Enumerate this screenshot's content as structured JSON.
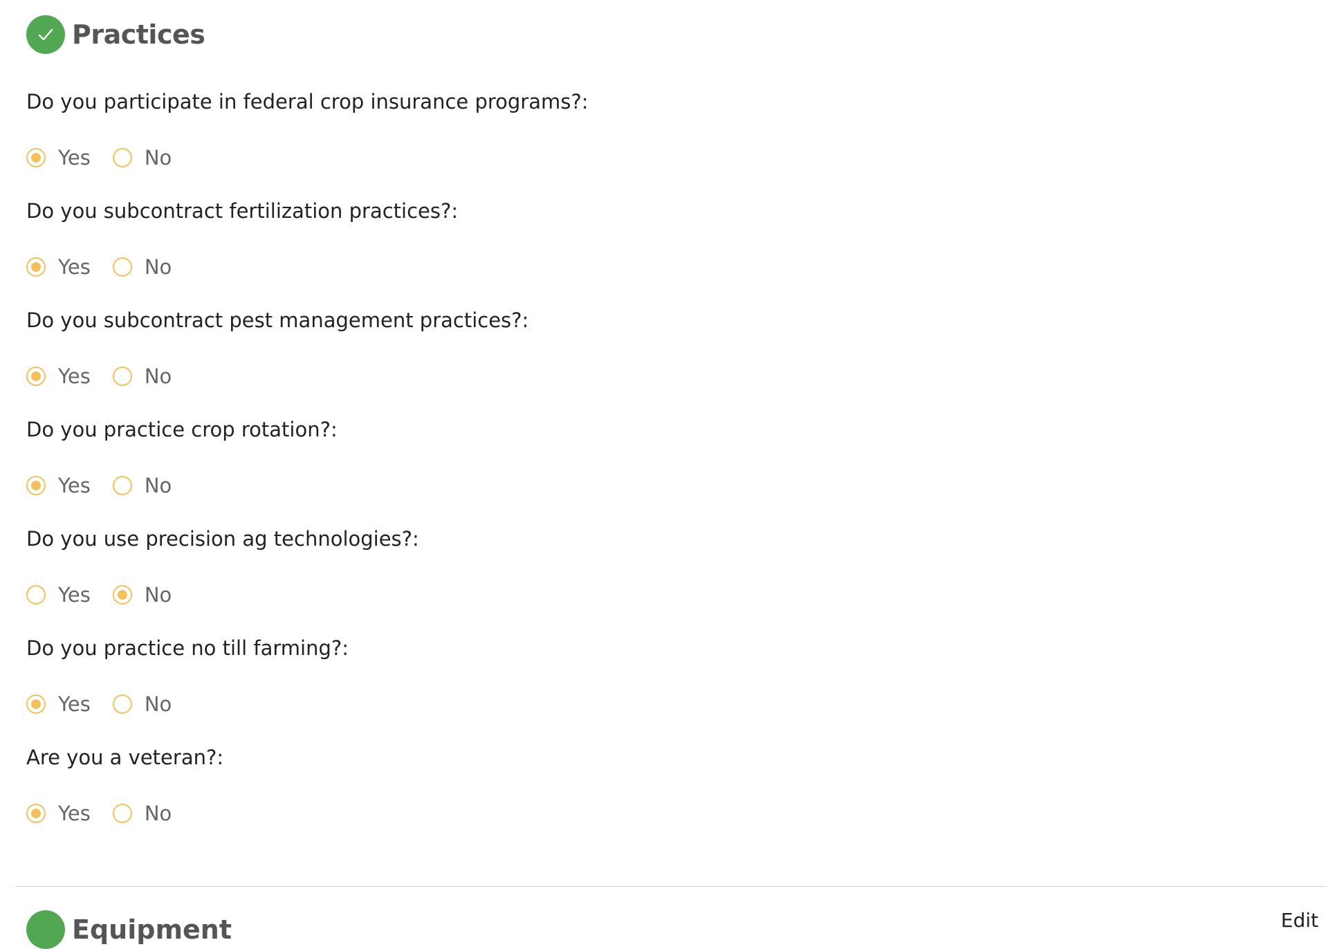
{
  "section": {
    "title": "Practices",
    "badge_color": "#52a852"
  },
  "radio_accent_color": "#f2c15b",
  "questions": [
    {
      "label": "Do you participate in federal crop insurance programs?:",
      "options": [
        "Yes",
        "No"
      ],
      "selected": "Yes"
    },
    {
      "label": "Do you subcontract fertilization practices?:",
      "options": [
        "Yes",
        "No"
      ],
      "selected": "Yes"
    },
    {
      "label": "Do you subcontract pest management practices?:",
      "options": [
        "Yes",
        "No"
      ],
      "selected": "Yes"
    },
    {
      "label": "Do you practice crop rotation?:",
      "options": [
        "Yes",
        "No"
      ],
      "selected": "Yes"
    },
    {
      "label": "Do you use precision ag technologies?:",
      "options": [
        "Yes",
        "No"
      ],
      "selected": "No"
    },
    {
      "label": "Do you practice no till farming?:",
      "options": [
        "Yes",
        "No"
      ],
      "selected": "Yes"
    },
    {
      "label": "Are you a veteran?:",
      "options": [
        "Yes",
        "No"
      ],
      "selected": "Yes"
    }
  ],
  "next_section": {
    "title": "Equipment",
    "edit_label": "Edit"
  }
}
